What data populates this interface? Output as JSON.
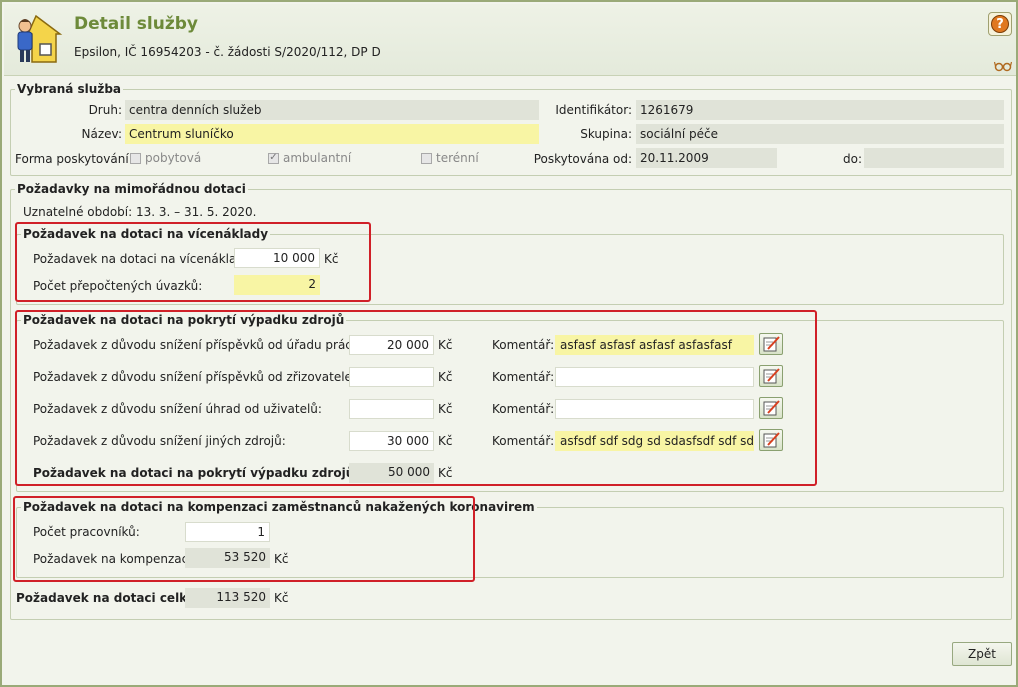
{
  "header": {
    "title": "Detail služby",
    "subtitle": "Epsilon, IČ 16954203 - č. žádosti S/2020/112, DP D"
  },
  "service": {
    "legend": "Vybraná služba",
    "druh_label": "Druh:",
    "druh_value": "centra denních služeb",
    "nazev_label": "Název:",
    "nazev_value": "Centrum sluníčko",
    "identifikator_label": "Identifikátor:",
    "identifikator_value": "1261679",
    "skupina_label": "Skupina:",
    "skupina_value": "sociální péče",
    "forma_label": "Forma poskytování:",
    "forma_options": [
      {
        "label": "pobytová",
        "checked": false
      },
      {
        "label": "ambulantní",
        "checked": true
      },
      {
        "label": "terénní",
        "checked": false
      }
    ],
    "od_label": "Poskytována od:",
    "od_value": "20.11.2009",
    "do_label": "do:",
    "do_value": ""
  },
  "requests": {
    "legend": "Požadavky na mimořádnou dotaci",
    "period": "Uznatelné období: 13. 3. – 31. 5. 2020.",
    "currency": "Kč",
    "vicenaklady": {
      "legend": "Požadavek na dotaci na vícenáklady",
      "amount_label": "Požadavek na dotaci na vícenáklady:",
      "amount_value": "10 000",
      "uvazky_label": "Počet přepočtených úvazků:",
      "uvazky_value": "2"
    },
    "vypadek": {
      "legend": "Požadavek na dotaci na pokrytí výpadku zdrojů",
      "comment_label": "Komentář:",
      "rows": [
        {
          "label": "Požadavek z důvodu snížení příspěvků od úřadu práce:",
          "value": "20 000",
          "comment": "asfasf asfasf asfasf asfasfasf"
        },
        {
          "label": "Požadavek z důvodu snížení příspěvků od zřizovatele:",
          "value": "",
          "comment": ""
        },
        {
          "label": "Požadavek z důvodu snížení úhrad od uživatelů:",
          "value": "",
          "comment": ""
        },
        {
          "label": "Požadavek z důvodu snížení jiných zdrojů:",
          "value": "30 000",
          "comment": "asfsdf sdf sdg sd sdasfsdf sdf sdg sd"
        }
      ],
      "total_label": "Požadavek na dotaci na pokrytí výpadku zdrojů celkem:",
      "total_value": "50 000"
    },
    "kompenzace": {
      "legend": "Požadavek na dotaci na kompenzaci zaměstnanců nakažených koronavirem",
      "workers_label": "Počet pracovníků:",
      "workers_value": "1",
      "amount_label": "Požadavek na kompenzaci:",
      "amount_value": "53 520"
    },
    "total_label": "Požadavek na dotaci celkem:",
    "total_value": "113 520"
  },
  "footer": {
    "back_label": "Zpět"
  },
  "colors": {
    "title_green": "#6d8a3a",
    "highlight_red": "#d02028",
    "yellow_field": "#f8f5a4"
  }
}
